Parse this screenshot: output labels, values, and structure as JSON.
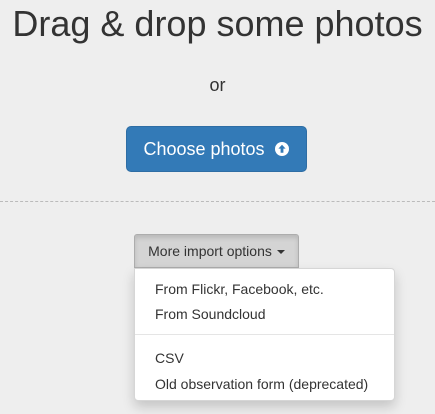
{
  "heading": "Drag & drop some photos",
  "or_text": "or",
  "choose_button": {
    "label": "Choose photos",
    "icon": "arrow-circle-up-icon",
    "color": "#337ab7"
  },
  "more_button": {
    "label": "More import options",
    "icon": "caret-down-icon"
  },
  "dropdown": {
    "items": [
      {
        "label": "From Flickr, Facebook, etc."
      },
      {
        "label": "From Soundcloud"
      },
      {
        "label": "CSV"
      },
      {
        "label": "Old observation form (deprecated)"
      }
    ]
  }
}
